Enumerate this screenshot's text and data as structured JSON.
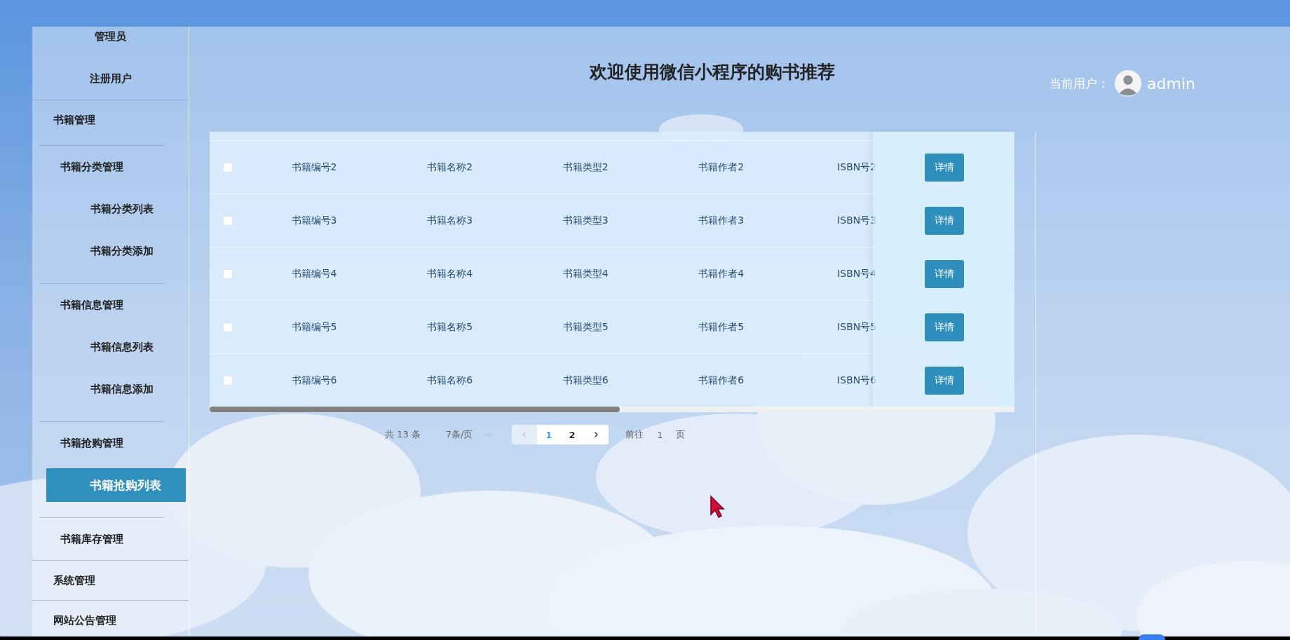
{
  "sidebar": {
    "items": [
      {
        "kind": "leaf",
        "label": "管理员",
        "selected": false
      },
      {
        "kind": "leaf",
        "label": "注册用户",
        "selected": false
      },
      {
        "kind": "group",
        "label": "书籍管理",
        "children": [
          {
            "kind": "group",
            "label": "书籍分类管理",
            "children": [
              {
                "kind": "leaf",
                "label": "书籍分类列表",
                "selected": false
              },
              {
                "kind": "leaf",
                "label": "书籍分类添加",
                "selected": false
              }
            ]
          },
          {
            "kind": "group",
            "label": "书籍信息管理",
            "children": [
              {
                "kind": "leaf",
                "label": "书籍信息列表",
                "selected": false
              },
              {
                "kind": "leaf",
                "label": "书籍信息添加",
                "selected": false
              }
            ]
          },
          {
            "kind": "group",
            "label": "书籍抢购管理",
            "children": [
              {
                "kind": "leaf",
                "label": "书籍抢购列表",
                "selected": true
              }
            ]
          },
          {
            "kind": "group",
            "label": "书籍库存管理"
          }
        ]
      },
      {
        "kind": "group",
        "label": "系统管理"
      },
      {
        "kind": "group",
        "label": "网站公告管理"
      }
    ]
  },
  "header": {
    "title": "欢迎使用微信小程序的购书推荐",
    "user_label": "当前用户：",
    "username": "admin"
  },
  "table": {
    "rows": [
      {
        "checked": false,
        "cells": [
          "书籍编号2",
          "书籍名称2",
          "书籍类型2",
          "书籍作者2",
          "ISBN号2"
        ],
        "action": "详情"
      },
      {
        "checked": false,
        "cells": [
          "书籍编号3",
          "书籍名称3",
          "书籍类型3",
          "书籍作者3",
          "ISBN号3"
        ],
        "action": "详情"
      },
      {
        "checked": false,
        "cells": [
          "书籍编号4",
          "书籍名称4",
          "书籍类型4",
          "书籍作者4",
          "ISBN号4"
        ],
        "action": "详情"
      },
      {
        "checked": false,
        "cells": [
          "书籍编号5",
          "书籍名称5",
          "书籍类型5",
          "书籍作者5",
          "ISBN号5"
        ],
        "action": "详情"
      },
      {
        "checked": false,
        "cells": [
          "书籍编号6",
          "书籍名称6",
          "书籍类型6",
          "书籍作者6",
          "ISBN号6"
        ],
        "action": "详情"
      }
    ]
  },
  "pagination": {
    "total": "共 13 条",
    "page_size": "7条/页",
    "prev_disabled": true,
    "next_disabled": false,
    "pages": [
      {
        "label": "1",
        "selected": true
      },
      {
        "label": "2",
        "selected": false
      }
    ],
    "goto_label": "前往",
    "goto_value": "1",
    "goto_suffix": "页"
  }
}
